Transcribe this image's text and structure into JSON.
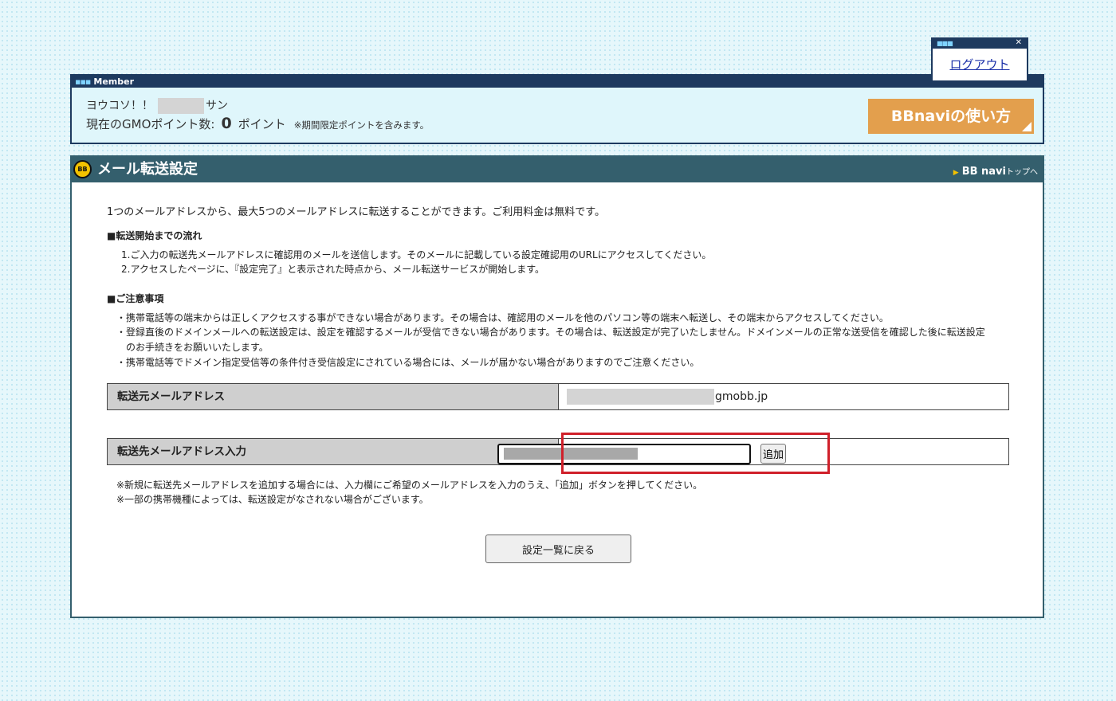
{
  "logout": {
    "label": "ログアウト"
  },
  "member": {
    "bar_title": "Member",
    "greeting": "ヨウコソ！！",
    "san": "サン",
    "points_label": "現在のGMOポイント数:",
    "points_value": "0",
    "points_unit": "ポイント",
    "points_note": "※期間限定ポイントを含みます。",
    "howto_button": "BBnaviの使い方"
  },
  "page": {
    "title": "メール転送設定",
    "logo_text": "BB",
    "top_link_main": "BB navi",
    "top_link_small": "トップへ",
    "intro": "1つのメールアドレスから、最大5つのメールアドレスに転送することができます。ご利用料金は無料です。",
    "flow": {
      "heading": "■転送開始までの流れ",
      "lines": [
        "1.ご入力の転送先メールアドレスに確認用のメールを送信します。そのメールに記載している設定確認用のURLにアクセスしてください。",
        "2.アクセスしたページに、『設定完了』と表示された時点から、メール転送サービスが開始します。"
      ]
    },
    "caution": {
      "heading": "■ご注意事項",
      "lines": [
        "・携帯電話等の端末からは正しくアクセスする事ができない場合があります。その場合は、確認用のメールを他のパソコン等の端末へ転送し、その端末からアクセスしてください。",
        "・登録直後のドメインメールへの転送設定は、設定を確認するメールが受信できない場合があります。その場合は、転送設定が完了いたしません。ドメインメールの正常な送受信を確認した後に転送設定",
        "のお手続きをお願いいたします。",
        "・携帯電話等でドメイン指定受信等の条件付き受信設定にされている場合には、メールが届かない場合がありますのでご注意ください。"
      ]
    },
    "source": {
      "label": "転送元メールアドレス",
      "domain": "gmobb.jp"
    },
    "dest": {
      "label": "転送先メールアドレス入力",
      "value": "",
      "add_button": "追加"
    },
    "notes": [
      "※新規に転送先メールアドレスを追加する場合には、入力欄にご希望のメールアドレスを入力のうえ、「追加」ボタンを押してください。",
      "※一部の携帯機種によっては、転送設定がなされない場合がございます。"
    ],
    "back_button": "設定一覧に戻る"
  }
}
